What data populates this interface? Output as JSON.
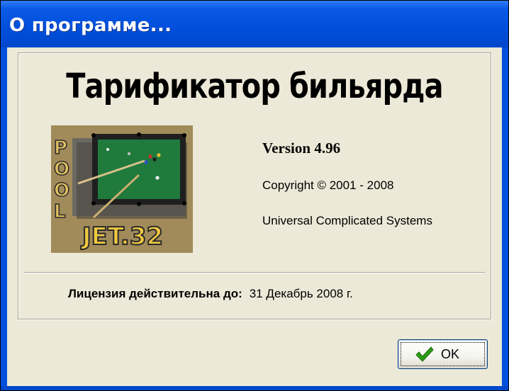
{
  "window": {
    "title": "О программе...",
    "title_bar_color": "#0054e3"
  },
  "about": {
    "app_name": "Тарификатор бильярда",
    "version": "Version 4.96",
    "copyright": "Copyright © 2001 - 2008",
    "company": "Universal Complicated Systems",
    "logo": {
      "icon": "pool-jet32-logo",
      "side_text": "POOL",
      "brand_text": "JET.32"
    }
  },
  "license": {
    "label": "Лицензия действительна до:",
    "value": "31 Декабрь 2008 г."
  },
  "buttons": {
    "ok_label": "OK",
    "ok_icon": "checkmark-icon"
  },
  "colors": {
    "dialog_background": "#ece9d8",
    "checkmark": "#2e9a16",
    "table_felt": "#1f7a3c"
  }
}
